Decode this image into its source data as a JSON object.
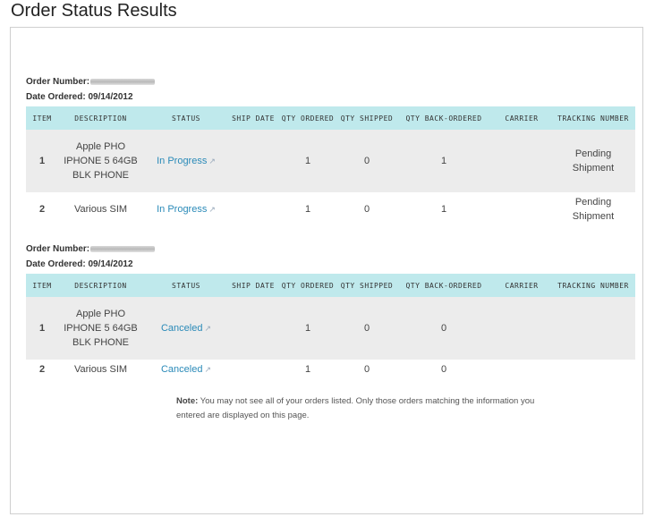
{
  "page_title": "Order Status Results",
  "columns": [
    "ITEM",
    "DESCRIPTION",
    "STATUS",
    "SHIP DATE",
    "QTY ORDERED",
    "QTY SHIPPED",
    "QTY BACK-ORDERED",
    "CARRIER",
    "TRACKING NUMBER"
  ],
  "orders": [
    {
      "order_number_label": "Order Number:",
      "date_label": "Date Ordered: 09/14/2012",
      "rows": [
        {
          "item": "1",
          "description": "Apple PHO IPHONE 5 64GB BLK PHONE",
          "status": "In Progress",
          "ship_date": "",
          "qty_ordered": "1",
          "qty_shipped": "0",
          "qty_back_ordered": "1",
          "carrier": "",
          "tracking": "Pending Shipment"
        },
        {
          "item": "2",
          "description": "Various SIM",
          "status": "In Progress",
          "ship_date": "",
          "qty_ordered": "1",
          "qty_shipped": "0",
          "qty_back_ordered": "1",
          "carrier": "",
          "tracking": "Pending Shipment"
        }
      ]
    },
    {
      "order_number_label": "Order Number:",
      "date_label": "Date Ordered: 09/14/2012",
      "rows": [
        {
          "item": "1",
          "description": "Apple PHO IPHONE 5 64GB BLK PHONE",
          "status": "Canceled",
          "ship_date": "",
          "qty_ordered": "1",
          "qty_shipped": "0",
          "qty_back_ordered": "0",
          "carrier": "",
          "tracking": ""
        },
        {
          "item": "2",
          "description": "Various SIM",
          "status": "Canceled",
          "ship_date": "",
          "qty_ordered": "1",
          "qty_shipped": "0",
          "qty_back_ordered": "0",
          "carrier": "",
          "tracking": ""
        }
      ]
    }
  ],
  "note": {
    "label": "Note:",
    "text": "You may not see all of your orders listed. Only those orders matching the information you entered are displayed on this page."
  },
  "colors": {
    "header_bg": "#bfe9ec",
    "link": "#2a8ab8",
    "row_shade": "#ececec"
  },
  "icons": {
    "status_link": "external-link-icon"
  }
}
